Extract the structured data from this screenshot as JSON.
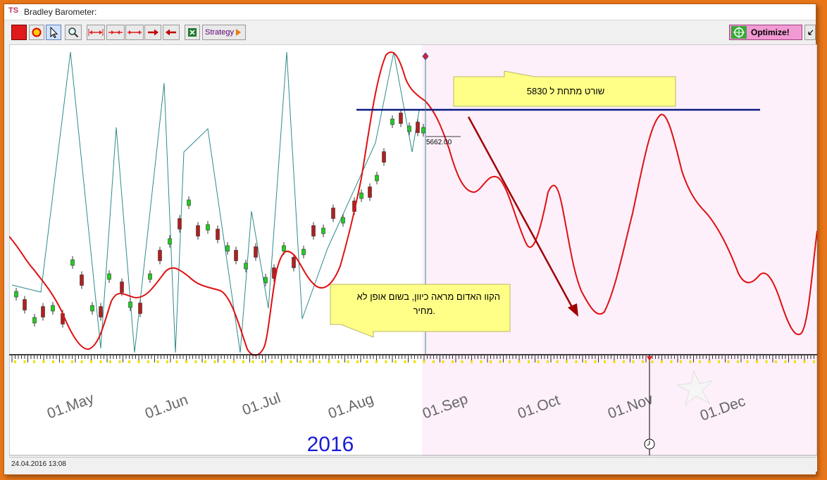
{
  "window": {
    "title": "Bradley Barometer:"
  },
  "toolbar": {
    "strategy_label": "Strategy",
    "optimize_label": "Optimize!"
  },
  "chart": {
    "months": [
      "01.May",
      "01.Jun",
      "01.Jul",
      "01.Aug",
      "01.Sep",
      "01.Oct",
      "01.Nov",
      "01.Dec"
    ],
    "year_label": "2016",
    "price_tag": "5662.00",
    "callout_short": "שורט מתחת ל 5830",
    "callout_red_line_1": "הקוו האדום מראה כיוון, בשום אופן לא",
    "callout_red_line_2": "מחיר.",
    "colors": {
      "red_line": "#e01010",
      "teal_line": "#2f8a8a",
      "horizontal_line": "#0d1a80",
      "arrow": "#a00000",
      "future_bg": "#fdf0fb",
      "callout_bg": "#ffff88",
      "year_color": "#1a1ad6"
    }
  },
  "status": {
    "datetime": "24.04.2016  13:08"
  }
}
